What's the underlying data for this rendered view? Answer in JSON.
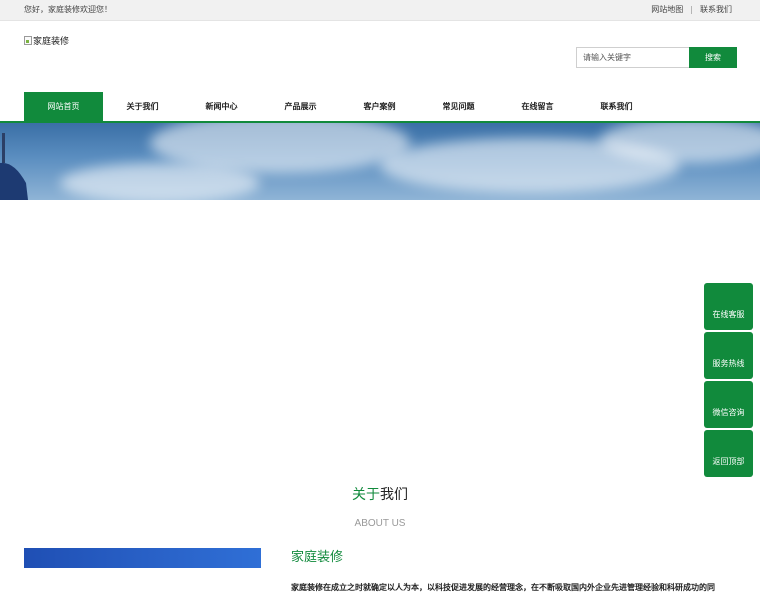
{
  "topbar": {
    "welcome": "您好，家庭装修欢迎您！",
    "links": [
      "网站地图",
      "联系我们"
    ],
    "separator": "|"
  },
  "header": {
    "logo_alt": "家庭装修"
  },
  "search": {
    "placeholder": "请输入关键字",
    "button_label": "搜索"
  },
  "nav": {
    "items": [
      "网站首页",
      "关于我们",
      "新闻中心",
      "产品展示",
      "客户案例",
      "常见问题",
      "在线留言",
      "联系我们"
    ],
    "active_index": 0
  },
  "about": {
    "title_green": "关于",
    "title_dark": "我们",
    "subtitle": "ABOUT US",
    "company_name": "家庭装修",
    "description": "家庭装修在成立之时就确定以人为本，以科技促进发展的经营理念，在不断吸取国内外企业先进管理经验和科研成功的同"
  },
  "sidebar": {
    "items": [
      "在线客服",
      "服务热线",
      "微信咨询",
      "返回顶部"
    ]
  },
  "colors": {
    "accent": "#118a3c",
    "topbar_bg": "#f1f1f1"
  }
}
